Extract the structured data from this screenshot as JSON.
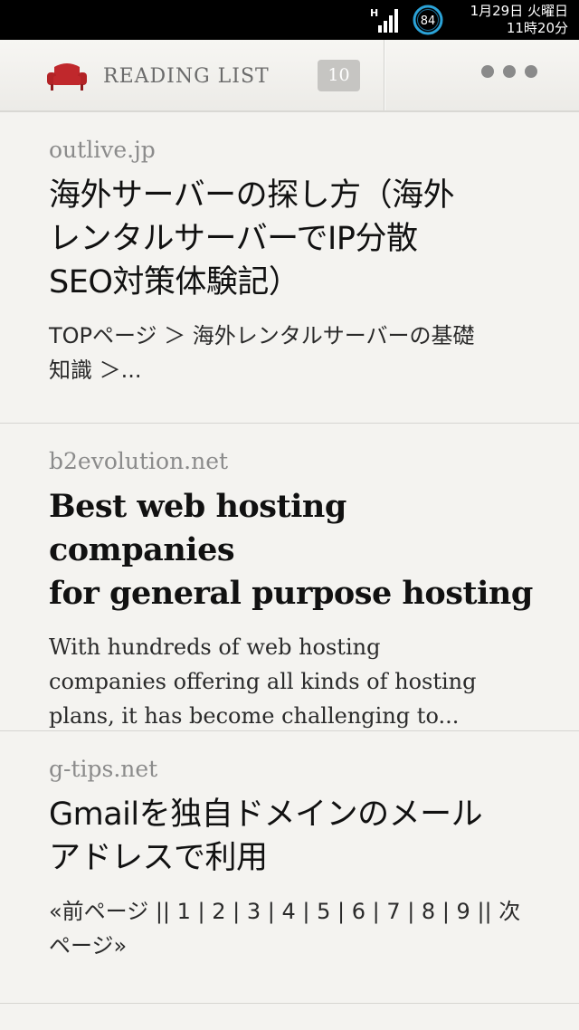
{
  "status_bar": {
    "signal_label": "H",
    "battery_level": "84",
    "date": "1月29日 火曜日",
    "time": "11時20分"
  },
  "toolbar": {
    "title": "READING LIST",
    "count": "10",
    "menu_icon": "more-dots-icon",
    "logo_icon": "armchair-icon",
    "logo_color": "#c0282c"
  },
  "articles": [
    {
      "domain": "outlive.jp",
      "title_line1": "海外サーバーの探し方（海外",
      "title_line2": "レンタルサーバーでIP分散",
      "title_line3": "SEO対策体験記）",
      "excerpt_line1": "TOPページ ＞ 海外レンタルサーバーの基礎",
      "excerpt_line2": "知識 ＞..."
    },
    {
      "domain": "b2evolution.net",
      "title_line1": "Best web hosting companies",
      "title_line2": "for general purpose hosting",
      "excerpt_line1": "With hundreds of web hosting",
      "excerpt_line2": "companies offering all kinds of hosting",
      "excerpt_line3": "plans, it has become challenging to..."
    },
    {
      "domain": "g-tips.net",
      "title_line1": "Gmailを独自ドメインのメール",
      "title_line2": "アドレスで利用",
      "excerpt_line1": "«前ページ || 1 | 2 | 3 | 4 | 5 | 6 | 7 | 8 | 9 || 次",
      "excerpt_line2": "ページ»"
    }
  ]
}
